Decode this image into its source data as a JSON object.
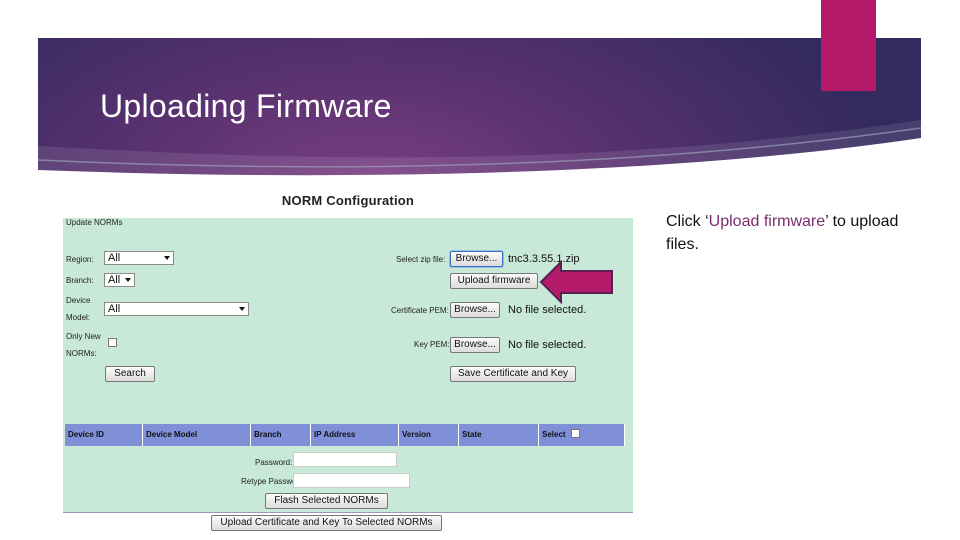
{
  "slide": {
    "title": "Uploading Firmware",
    "caption_before": "Click ‘",
    "caption_highlight": "Upload firmware",
    "caption_after": "’ to upload files."
  },
  "screenshot": {
    "title": "NORM Configuration",
    "section_label": "Update NORMs",
    "region": {
      "label": "Region:",
      "value": "All"
    },
    "branch": {
      "label": "Branch:",
      "value": "All"
    },
    "device_model": {
      "label_line1": "Device",
      "label_line2": "Model:",
      "value": "All"
    },
    "only_new": {
      "label_line1": "Only New",
      "label_line2": "NORMs:",
      "checked": false
    },
    "search_button": "Search",
    "zip_file": {
      "label": "Select zip file:",
      "browse": "Browse...",
      "file_name": "tnc3.3.55.1.zip"
    },
    "upload_firmware_button": "Upload firmware",
    "certificate_pem": {
      "label": "Certificate PEM:",
      "browse": "Browse...",
      "status": "No file selected."
    },
    "key_pem": {
      "label": "Key PEM:",
      "browse": "Browse...",
      "status": "No file selected."
    },
    "save_cert_button": "Save Certificate and Key",
    "table_headers": [
      "Device ID",
      "Device Model",
      "Branch",
      "IP Address",
      "Version",
      "State",
      "Select"
    ],
    "password_label": "Password:",
    "retype_password_label": "Retype Password:",
    "flash_button": "Flash Selected NORMs",
    "upload_cert_button": "Upload Certificate and Key To Selected NORMs"
  },
  "colors": {
    "banner": "#4a2d68",
    "accent_pink": "#b5196a",
    "panel_bg": "#c8e8d8",
    "table_header": "#7f8fd8"
  }
}
